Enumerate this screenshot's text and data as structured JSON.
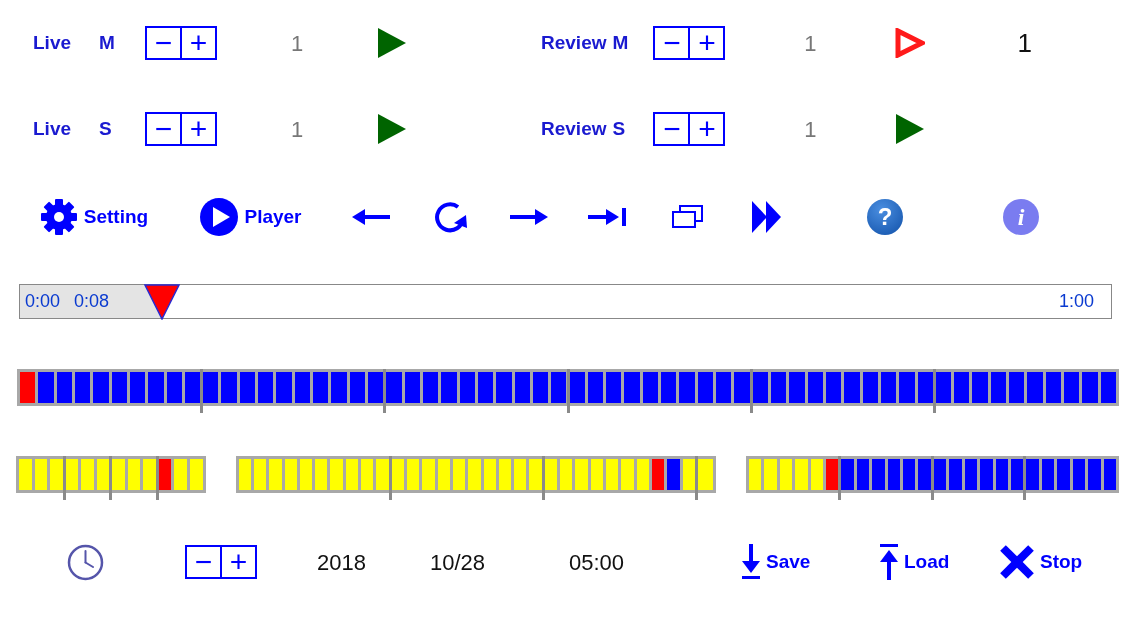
{
  "channels": [
    {
      "name": "Live",
      "channel": "M",
      "minus": "−",
      "plus": "+",
      "count": "1",
      "active": false
    },
    {
      "name": "Review",
      "channel": "M",
      "minus": "−",
      "plus": "+",
      "count": "1",
      "active": true,
      "extra": "1"
    },
    {
      "name": "Live",
      "channel": "S",
      "minus": "−",
      "plus": "+",
      "count": "1",
      "active": false
    },
    {
      "name": "Review",
      "channel": "S",
      "minus": "−",
      "plus": "+",
      "count": "1",
      "active": false
    }
  ],
  "toolbar": [
    {
      "kind": "settings",
      "label": "Setting"
    },
    {
      "kind": "player",
      "label": "Player"
    },
    {
      "kind": "back"
    },
    {
      "kind": "refresh"
    },
    {
      "kind": "forward"
    },
    {
      "kind": "skip"
    },
    {
      "kind": "windows"
    },
    {
      "kind": "fast_forward"
    },
    {
      "kind": "help",
      "glyph": "?"
    },
    {
      "kind": "info",
      "glyph": "i"
    }
  ],
  "position": {
    "start": "0:00",
    "current": "0:08",
    "end": "1:00",
    "level": 0.13
  },
  "timeline": {
    "groups": [
      {
        "cells": [
          {
            "color": "#ff0000"
          },
          {
            "color": "#0000ff"
          },
          {
            "color": "#0000ff"
          },
          {
            "color": "#0000ff"
          },
          {
            "color": "#0000ff"
          },
          {
            "color": "#0000ff"
          },
          {
            "color": "#0000ff"
          },
          {
            "color": "#0000ff"
          },
          {
            "color": "#0000ff"
          },
          {
            "color": "#0000ff"
          }
        ]
      },
      {
        "cells": [
          {
            "color": "#0000ff"
          },
          {
            "color": "#0000ff"
          },
          {
            "color": "#0000ff"
          },
          {
            "color": "#0000ff"
          },
          {
            "color": "#0000ff"
          },
          {
            "color": "#0000ff"
          },
          {
            "color": "#0000ff"
          },
          {
            "color": "#0000ff"
          },
          {
            "color": "#0000ff"
          },
          {
            "color": "#0000ff"
          }
        ]
      },
      {
        "cells": [
          {
            "color": "#0000ff"
          },
          {
            "color": "#0000ff"
          },
          {
            "color": "#0000ff"
          },
          {
            "color": "#0000ff"
          },
          {
            "color": "#0000ff"
          },
          {
            "color": "#0000ff"
          },
          {
            "color": "#0000ff"
          },
          {
            "color": "#0000ff"
          },
          {
            "color": "#0000ff"
          },
          {
            "color": "#0000ff"
          }
        ]
      },
      {
        "cells": [
          {
            "color": "#0000ff"
          },
          {
            "color": "#0000ff"
          },
          {
            "color": "#0000ff"
          },
          {
            "color": "#0000ff"
          },
          {
            "color": "#0000ff"
          },
          {
            "color": "#0000ff"
          },
          {
            "color": "#0000ff"
          },
          {
            "color": "#0000ff"
          },
          {
            "color": "#0000ff"
          },
          {
            "color": "#0000ff"
          }
        ]
      },
      {
        "cells": [
          {
            "color": "#0000ff"
          },
          {
            "color": "#0000ff"
          },
          {
            "color": "#0000ff"
          },
          {
            "color": "#0000ff"
          },
          {
            "color": "#0000ff"
          },
          {
            "color": "#0000ff"
          },
          {
            "color": "#0000ff"
          },
          {
            "color": "#0000ff"
          },
          {
            "color": "#0000ff"
          },
          {
            "color": "#0000ff"
          }
        ]
      },
      {
        "cells": [
          {
            "color": "#0000ff"
          },
          {
            "color": "#0000ff"
          },
          {
            "color": "#0000ff"
          },
          {
            "color": "#0000ff"
          },
          {
            "color": "#0000ff"
          },
          {
            "color": "#0000ff"
          },
          {
            "color": "#0000ff"
          },
          {
            "color": "#0000ff"
          },
          {
            "color": "#0000ff"
          },
          {
            "color": "#0000ff"
          }
        ]
      }
    ]
  },
  "segments": [
    {
      "groups": [
        {
          "cells": [
            {
              "color": "#ffff00"
            },
            {
              "color": "#ffff00"
            },
            {
              "color": "#ffff00"
            }
          ]
        },
        {
          "cells": [
            {
              "color": "#ffff00"
            },
            {
              "color": "#ffff00"
            },
            {
              "color": "#ffff00"
            }
          ]
        },
        {
          "cells": [
            {
              "color": "#ffff00"
            },
            {
              "color": "#ffff00"
            },
            {
              "color": "#ffff00"
            }
          ]
        },
        {
          "cells": [
            {
              "color": "#ff0000"
            },
            {
              "color": "#ffff00"
            },
            {
              "color": "#ffff00"
            }
          ]
        }
      ]
    },
    {
      "groups": [
        {
          "cells": [
            {
              "color": "#ffff00"
            },
            {
              "color": "#ffff00"
            },
            {
              "color": "#ffff00"
            },
            {
              "color": "#ffff00"
            },
            {
              "color": "#ffff00"
            },
            {
              "color": "#ffff00"
            },
            {
              "color": "#ffff00"
            },
            {
              "color": "#ffff00"
            },
            {
              "color": "#ffff00"
            },
            {
              "color": "#ffff00"
            }
          ]
        },
        {
          "cells": [
            {
              "color": "#ffff00"
            },
            {
              "color": "#ffff00"
            },
            {
              "color": "#ffff00"
            },
            {
              "color": "#ffff00"
            },
            {
              "color": "#ffff00"
            },
            {
              "color": "#ffff00"
            },
            {
              "color": "#ffff00"
            },
            {
              "color": "#ffff00"
            },
            {
              "color": "#ffff00"
            },
            {
              "color": "#ffff00"
            }
          ]
        },
        {
          "cells": [
            {
              "color": "#ffff00"
            },
            {
              "color": "#ffff00"
            },
            {
              "color": "#ffff00"
            },
            {
              "color": "#ffff00"
            },
            {
              "color": "#ffff00"
            },
            {
              "color": "#ffff00"
            },
            {
              "color": "#ffff00"
            },
            {
              "color": "#ff0000"
            },
            {
              "color": "#0000ff"
            },
            {
              "color": "#ffff00"
            }
          ]
        },
        {
          "cells": [
            {
              "color": "#ffff00"
            }
          ]
        }
      ]
    },
    {
      "groups": [
        {
          "cells": [
            {
              "color": "#ffff00"
            },
            {
              "color": "#ffff00"
            },
            {
              "color": "#ffff00"
            },
            {
              "color": "#ffff00"
            },
            {
              "color": "#ffff00"
            },
            {
              "color": "#ff0000"
            }
          ]
        },
        {
          "cells": [
            {
              "color": "#0000ff"
            },
            {
              "color": "#0000ff"
            },
            {
              "color": "#0000ff"
            },
            {
              "color": "#0000ff"
            },
            {
              "color": "#0000ff"
            },
            {
              "color": "#0000ff"
            }
          ]
        },
        {
          "cells": [
            {
              "color": "#0000ff"
            },
            {
              "color": "#0000ff"
            },
            {
              "color": "#0000ff"
            },
            {
              "color": "#0000ff"
            },
            {
              "color": "#0000ff"
            },
            {
              "color": "#0000ff"
            }
          ]
        },
        {
          "cells": [
            {
              "color": "#0000ff"
            },
            {
              "color": "#0000ff"
            },
            {
              "color": "#0000ff"
            },
            {
              "color": "#0000ff"
            },
            {
              "color": "#0000ff"
            },
            {
              "color": "#0000ff"
            }
          ]
        }
      ]
    }
  ],
  "footer": {
    "minus": "−",
    "plus": "+",
    "year": "2018",
    "date": "10/28",
    "time": "05:00",
    "actions": [
      {
        "kind": "save",
        "label": "Save"
      },
      {
        "kind": "load",
        "label": "Load"
      },
      {
        "kind": "stop",
        "label": "Stop"
      }
    ]
  }
}
